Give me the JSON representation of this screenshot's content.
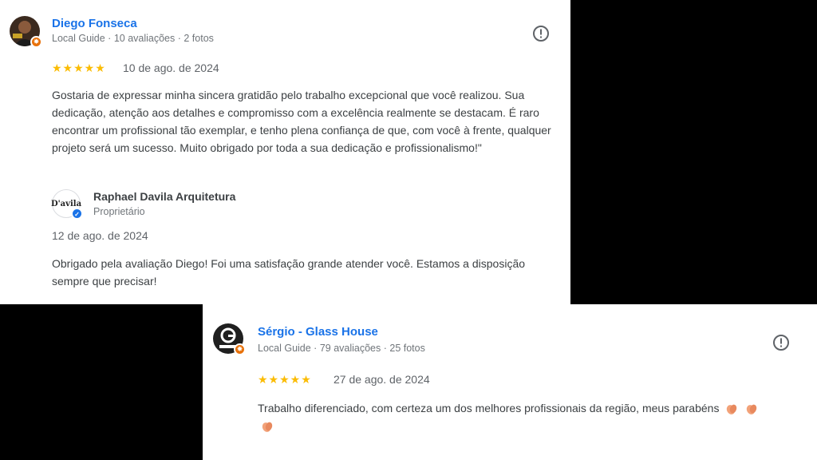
{
  "review1": {
    "author": "Diego Fonseca",
    "meta": "Local Guide · 10 avaliações · 2 fotos",
    "stars": "★★★★★",
    "rating": 5,
    "date": "10 de ago. de 2024",
    "text": "Gostaria de expressar minha sincera gratidão pelo trabalho excepcional que você realizou. Sua dedicação, atenção aos detalhes e compromisso com a excelência realmente se destacam. É raro encontrar um profissional tão exemplar, e tenho plena confiança de que, com você à frente, qualquer projeto será um sucesso. Muito obrigado por toda a sua dedicação e profissionalismo!\"",
    "reply": {
      "owner": "Raphael Davila Arquitetura",
      "role": "Proprietário",
      "logo_text": "D'avila",
      "date": "12 de ago. de 2024",
      "text": "Obrigado pela avaliação Diego! Foi uma satisfação grande atender você. Estamos a disposição sempre que precisar!"
    }
  },
  "review2": {
    "author": "Sérgio - Glass House",
    "meta": "Local Guide · 79 avaliações · 25 fotos",
    "stars": "★★★★★",
    "rating": 5,
    "date": "27 de ago. de 2024",
    "text": "Trabalho diferenciado, com certeza um dos melhores profissionais da região, meus parabéns"
  },
  "colors": {
    "author_link": "#1a73e8",
    "star": "#fbbc04",
    "guide_badge": "#e8710a",
    "background": "#000000"
  },
  "icons": {
    "report": "report-icon",
    "guide": "local-guide-badge-icon",
    "verified": "verified-check-icon",
    "clap": "clapping-hands-icon"
  }
}
